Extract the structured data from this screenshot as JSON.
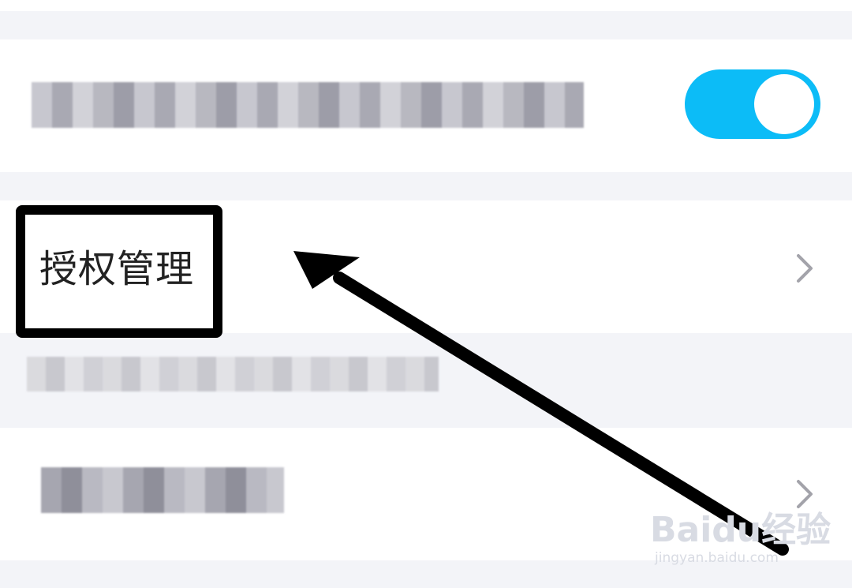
{
  "settings": {
    "rows": [
      {
        "id": "toggle-row",
        "toggle_on": true,
        "toggle_color": "#0cbcf7"
      },
      {
        "id": "authorization-row",
        "label": "授权管理",
        "chevron": "chevron-right-icon"
      },
      {
        "id": "last-row",
        "chevron": "chevron-right-icon"
      }
    ]
  },
  "watermark": {
    "main": "Baidu经验",
    "sub": "jingyan.baidu.com"
  },
  "colors": {
    "background": "#f3f4f8",
    "row": "#ffffff",
    "accent": "#0cbcf7",
    "annotation": "#000000"
  }
}
